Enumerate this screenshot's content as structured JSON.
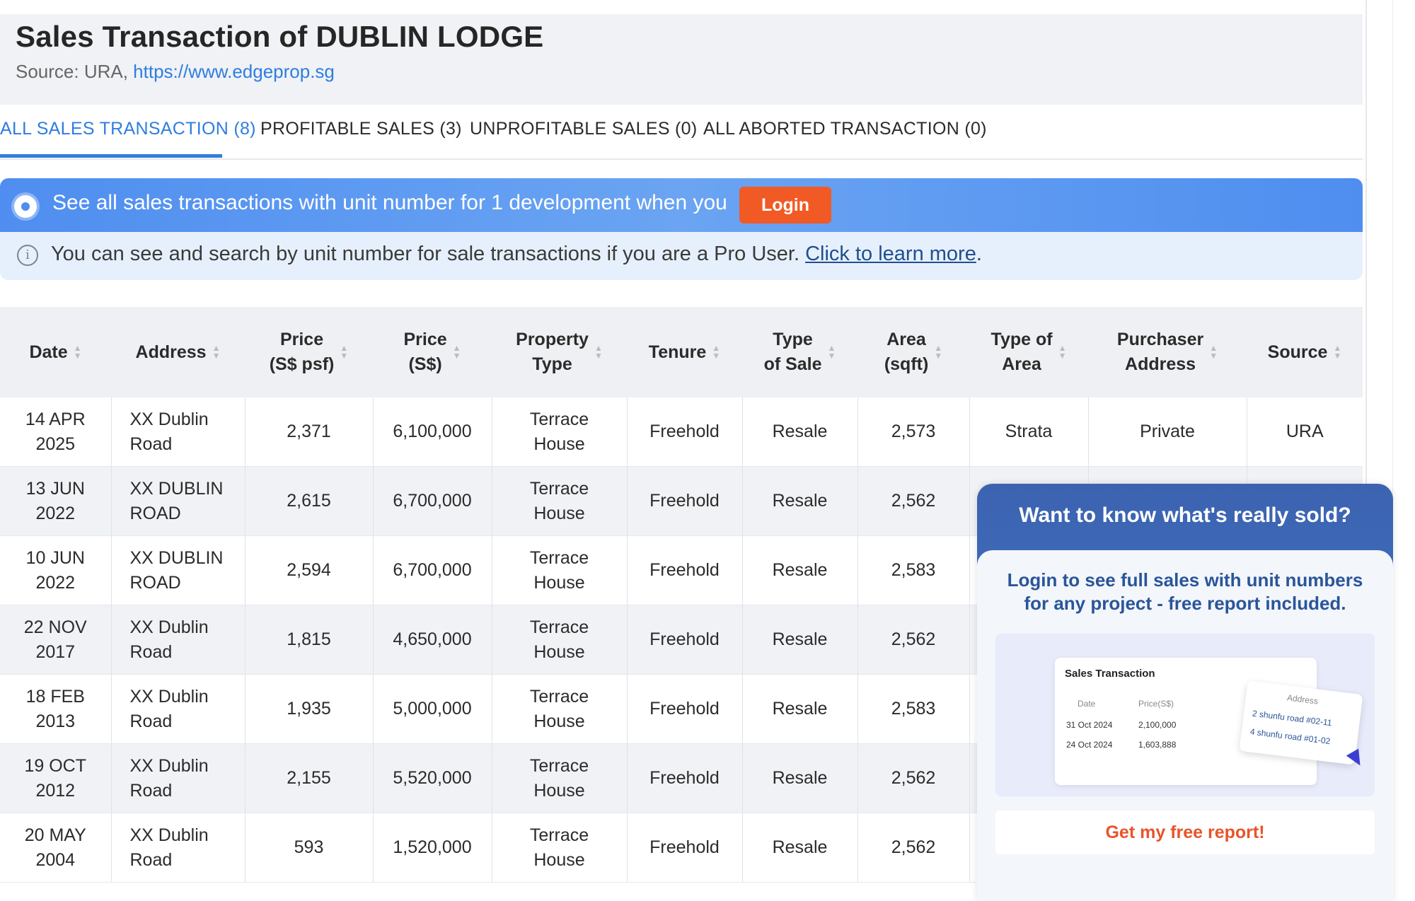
{
  "page": {
    "title": "Sales Transaction of DUBLIN LODGE",
    "source_prefix": "Source: URA, ",
    "source_link": "https://www.edgeprop.sg"
  },
  "tabs": [
    {
      "label": "ALL SALES TRANSACTION (8)",
      "active": true
    },
    {
      "label": "PROFITABLE SALES (3)",
      "active": false
    },
    {
      "label": "UNPROFITABLE SALES (0)",
      "active": false
    },
    {
      "label": "ALL ABORTED TRANSACTION (0)",
      "active": false
    }
  ],
  "banner": {
    "text": "See all sales transactions with unit number for 1 development when you",
    "login_label": "Login"
  },
  "info": {
    "text": "You can see and search by unit number for sale transactions if you are a Pro User. ",
    "link": "Click to learn more",
    "suffix": "."
  },
  "table": {
    "headers": [
      [
        "Date"
      ],
      [
        "Address"
      ],
      [
        "Price",
        "(S$ psf)"
      ],
      [
        "Price",
        "(S$)"
      ],
      [
        "Property",
        "Type"
      ],
      [
        "Tenure"
      ],
      [
        "Type",
        "of Sale"
      ],
      [
        "Area",
        "(sqft)"
      ],
      [
        "Type of",
        "Area"
      ],
      [
        "Purchaser",
        "Address"
      ],
      [
        "Source"
      ]
    ],
    "rows": [
      {
        "date": [
          "14 APR",
          "2025"
        ],
        "address": [
          "XX Dublin",
          "Road"
        ],
        "psf": "2,371",
        "price": "6,100,000",
        "ptype": [
          "Terrace",
          "House"
        ],
        "tenure": "Freehold",
        "sale": "Resale",
        "area": "2,573",
        "area_type": "Strata",
        "purchaser": "Private",
        "source": "URA"
      },
      {
        "date": [
          "13 JUN",
          "2022"
        ],
        "address": [
          "XX DUBLIN",
          "ROAD"
        ],
        "psf": "2,615",
        "price": "6,700,000",
        "ptype": [
          "Terrace",
          "House"
        ],
        "tenure": "Freehold",
        "sale": "Resale",
        "area": "2,562",
        "area_type": "",
        "purchaser": "",
        "source": ""
      },
      {
        "date": [
          "10 JUN",
          "2022"
        ],
        "address": [
          "XX DUBLIN",
          "ROAD"
        ],
        "psf": "2,594",
        "price": "6,700,000",
        "ptype": [
          "Terrace",
          "House"
        ],
        "tenure": "Freehold",
        "sale": "Resale",
        "area": "2,583",
        "area_type": "",
        "purchaser": "",
        "source": ""
      },
      {
        "date": [
          "22 NOV",
          "2017"
        ],
        "address": [
          "XX Dublin",
          "Road"
        ],
        "psf": "1,815",
        "price": "4,650,000",
        "ptype": [
          "Terrace",
          "House"
        ],
        "tenure": "Freehold",
        "sale": "Resale",
        "area": "2,562",
        "area_type": "",
        "purchaser": "",
        "source": ""
      },
      {
        "date": [
          "18 FEB",
          "2013"
        ],
        "address": [
          "XX Dublin",
          "Road"
        ],
        "psf": "1,935",
        "price": "5,000,000",
        "ptype": [
          "Terrace",
          "House"
        ],
        "tenure": "Freehold",
        "sale": "Resale",
        "area": "2,583",
        "area_type": "",
        "purchaser": "",
        "source": ""
      },
      {
        "date": [
          "19 OCT",
          "2012"
        ],
        "address": [
          "XX Dublin",
          "Road"
        ],
        "psf": "2,155",
        "price": "5,520,000",
        "ptype": [
          "Terrace",
          "House"
        ],
        "tenure": "Freehold",
        "sale": "Resale",
        "area": "2,562",
        "area_type": "",
        "purchaser": "",
        "source": ""
      },
      {
        "date": [
          "20 MAY",
          "2004"
        ],
        "address": [
          "XX Dublin",
          "Road"
        ],
        "psf": "593",
        "price": "1,520,000",
        "ptype": [
          "Terrace",
          "House"
        ],
        "tenure": "Freehold",
        "sale": "Resale",
        "area": "2,562",
        "area_type": "",
        "purchaser": "",
        "source": ""
      }
    ]
  },
  "popup": {
    "title": "Want to know what's really sold?",
    "subtitle": "Login to see full sales with unit numbers for any project - free report included.",
    "preview": {
      "title": "Sales Transaction",
      "col_date": "Date",
      "col_price": "Price(S$)",
      "col_address": "Address",
      "rows": [
        {
          "date": "31 Oct 2024",
          "price": "2,100,000",
          "address": "2 shunfu road #02-11"
        },
        {
          "date": "24 Oct 2024",
          "price": "1,603,888",
          "address": "4 shunfu road #01-02"
        }
      ]
    },
    "cta_label": "Get my free report!"
  },
  "colors": {
    "accent_blue": "#2f7de0",
    "login_orange": "#f15a24",
    "popup_blue": "#3b63b0",
    "cta_text": "#e8542a"
  }
}
